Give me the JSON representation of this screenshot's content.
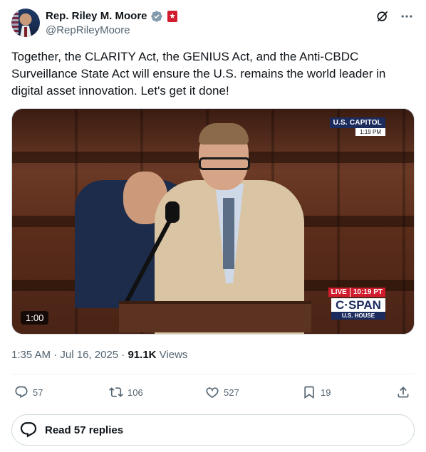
{
  "author": {
    "name": "Rep. Riley M. Moore",
    "handle": "@RepRileyMoore"
  },
  "tweet": {
    "text": "Together, the CLARITY Act, the GENIUS Act, and the Anti-CBDC Surveillance State Act will ensure the U.S. remains the world leader in digital asset innovation. Let's get it done!"
  },
  "media": {
    "duration": "1:00",
    "overlay_capitol": "U.S. CAPITOL",
    "overlay_capitol_time": "1:19 PM",
    "overlay_live": "LIVE",
    "overlay_live_time": "10:19 PT",
    "overlay_network": "C·SPAN",
    "overlay_network_sub": "U.S. HOUSE"
  },
  "meta": {
    "time": "1:35 AM",
    "date": "Jul 16, 2025",
    "views_count": "91.1K",
    "views_label": "Views"
  },
  "actions": {
    "replies": "57",
    "reposts": "106",
    "likes": "527",
    "bookmarks": "19"
  },
  "read_replies": "Read 57 replies",
  "colors": {
    "verified": "#829aab",
    "gov_badge": "#d01c2c",
    "text_secondary": "#536471"
  }
}
